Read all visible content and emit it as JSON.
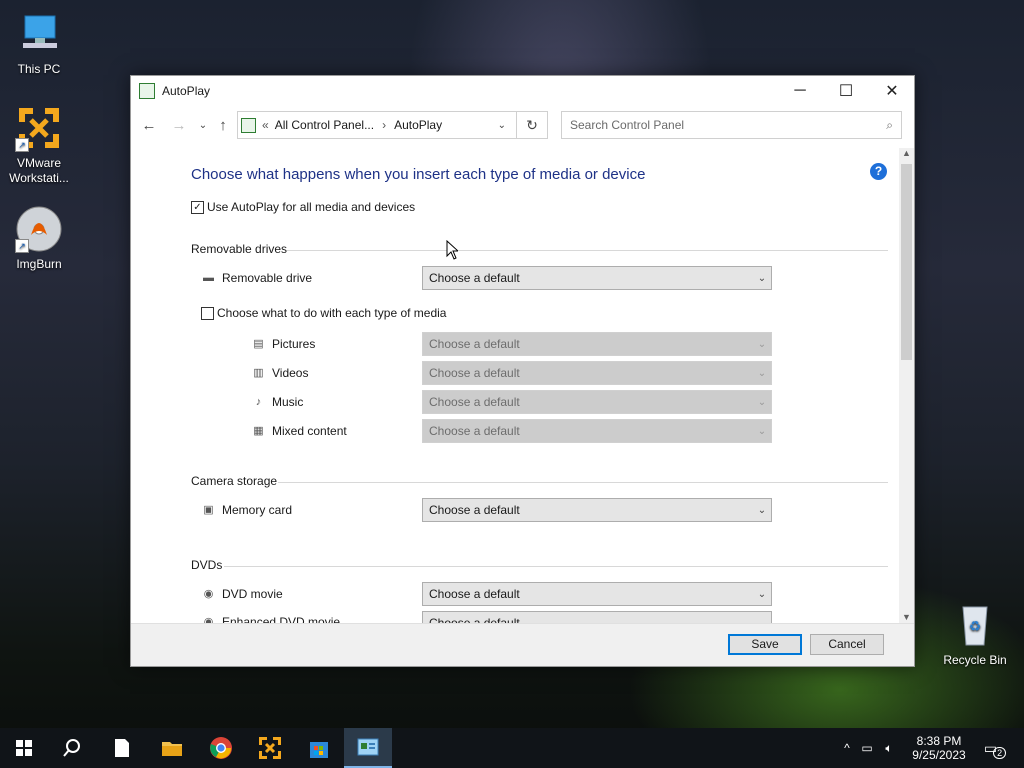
{
  "desktop": {
    "icons": [
      {
        "label": "This PC",
        "icon": "computer-icon"
      },
      {
        "label": "VMware Workstati...",
        "icon": "vmware-icon"
      },
      {
        "label": "ImgBurn",
        "icon": "disc-burn-icon"
      },
      {
        "label": "Recycle Bin",
        "icon": "recycle-bin-icon"
      }
    ]
  },
  "window": {
    "title": "AutoPlay",
    "breadcrumb": {
      "prefix": "«",
      "parent": "All Control Panel...",
      "separator": "›",
      "current": "AutoPlay"
    },
    "search_placeholder": "Search Control Panel"
  },
  "autoplay": {
    "heading": "Choose what happens when you insert each type of media or device",
    "use_autoplay_label": "Use AutoPlay for all media and devices",
    "use_autoplay_checked": true,
    "sections": {
      "removable": {
        "title": "Removable drives",
        "drive_label": "Removable drive",
        "drive_value": "Choose a default",
        "media_checkbox_label": "Choose what to do with each type of media",
        "media_checkbox_checked": false,
        "media": [
          {
            "label": "Pictures",
            "value": "Choose a default"
          },
          {
            "label": "Videos",
            "value": "Choose a default"
          },
          {
            "label": "Music",
            "value": "Choose a default"
          },
          {
            "label": "Mixed content",
            "value": "Choose a default"
          }
        ]
      },
      "camera": {
        "title": "Camera storage",
        "label": "Memory card",
        "value": "Choose a default"
      },
      "dvds": {
        "title": "DVDs",
        "items": [
          {
            "label": "DVD movie",
            "value": "Choose a default"
          },
          {
            "label": "Enhanced DVD movie",
            "value": "Choose a default"
          }
        ]
      }
    }
  },
  "footer": {
    "save": "Save",
    "cancel": "Cancel"
  },
  "taskbar": {
    "time": "8:38 PM",
    "date": "9/25/2023",
    "notification_count": "2"
  }
}
